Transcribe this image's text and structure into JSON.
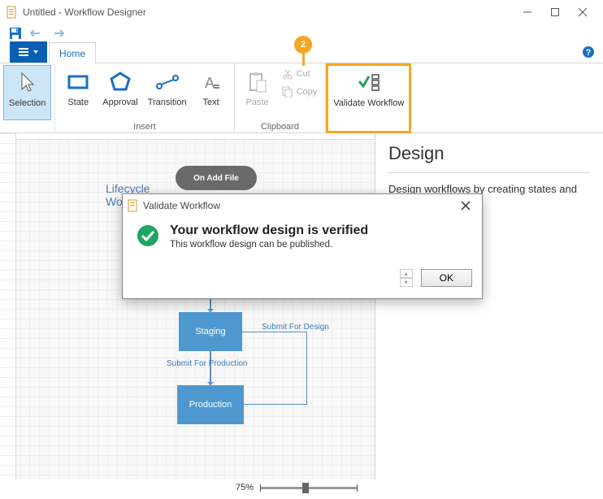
{
  "window": {
    "title": "Untitled - Workflow Designer"
  },
  "ribbon": {
    "tabs": {
      "home": "Home"
    },
    "selection": "Selection",
    "state": "State",
    "approval": "Approval",
    "transition": "Transition",
    "text": "Text",
    "paste": "Paste",
    "cut": "Cut",
    "copy": "Copy",
    "validate": "Validate Workflow",
    "group_insert": "Insert",
    "group_clipboard": "Clipboard"
  },
  "badge": {
    "number": "2"
  },
  "canvas": {
    "title_line1": "Lifecycle",
    "title_line2": "Workflow",
    "on_add_file": "On Add File",
    "staging": "Staging",
    "production": "Production",
    "submit_design": "Submit For Design",
    "submit_prod": "Submit For Production"
  },
  "side": {
    "title": "Design",
    "desc": "Design workflows by creating states and connecting"
  },
  "dialog": {
    "title": "Validate Workflow",
    "heading": "Your workflow design is verified",
    "message": "This workflow design can be published.",
    "ok": "OK"
  },
  "zoom": {
    "value": "75%"
  }
}
